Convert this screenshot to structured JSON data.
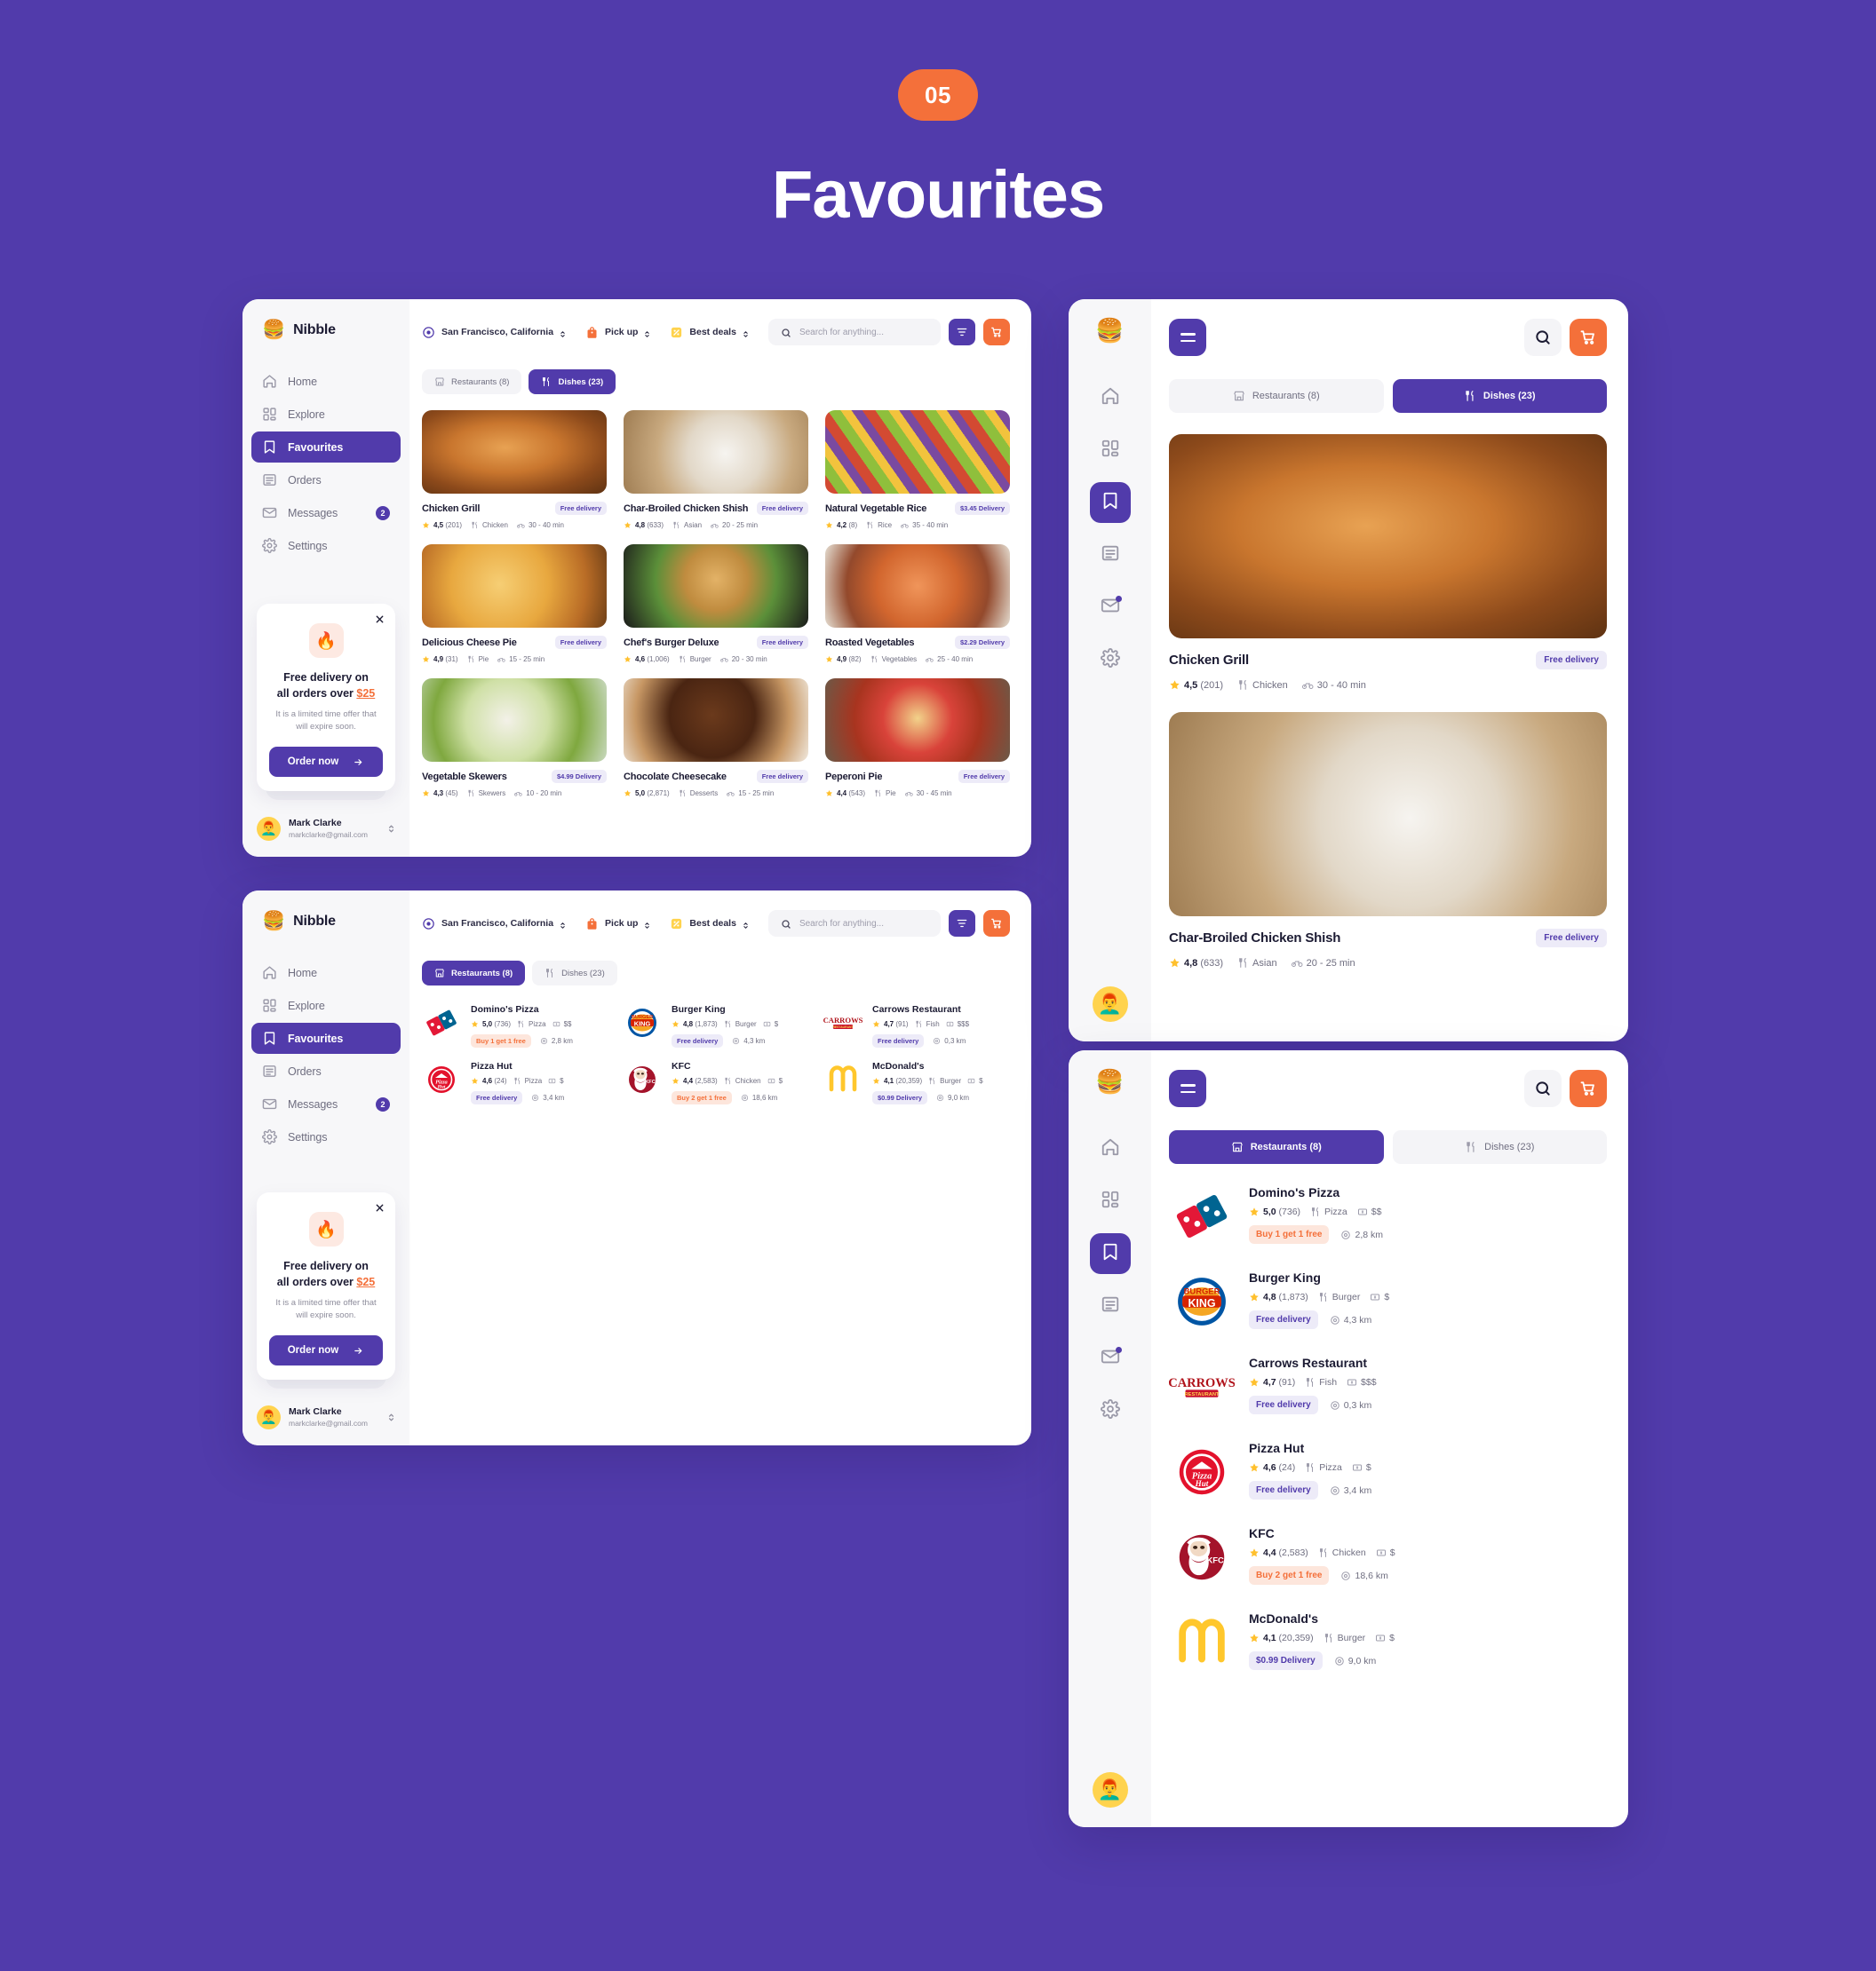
{
  "header": {
    "step": "05",
    "title": "Favourites"
  },
  "brand": {
    "name": "Nibble",
    "logo_icon": "burger-logo"
  },
  "sidebar": {
    "items": [
      {
        "label": "Home",
        "icon": "home-icon",
        "badge": ""
      },
      {
        "label": "Explore",
        "icon": "grid-icon",
        "badge": ""
      },
      {
        "label": "Favourites",
        "icon": "bookmark-icon",
        "badge": ""
      },
      {
        "label": "Orders",
        "icon": "list-icon",
        "badge": ""
      },
      {
        "label": "Messages",
        "icon": "mail-icon",
        "badge": "2"
      },
      {
        "label": "Settings",
        "icon": "gear-icon",
        "badge": ""
      }
    ],
    "active": "Favourites"
  },
  "promo": {
    "icon": "flame-icon",
    "close_icon": "close-icon",
    "title_line1": "Free delivery on",
    "title_line2": "all orders over ",
    "amount": "$25",
    "subtitle": "It is a limited time offer that will expire soon.",
    "button_label": "Order now",
    "button_icon": "arrow-right-icon"
  },
  "user": {
    "name": "Mark Clarke",
    "email": "markclarke@gmail.com",
    "avatar_icon": "avatar",
    "expander_icon": "chevron-updown-icon"
  },
  "toolbar": {
    "location": {
      "label": "San Francisco, California",
      "icon": "location-target-icon"
    },
    "mode": {
      "label": "Pick up",
      "icon": "bag-icon"
    },
    "deals": {
      "label": "Best deals",
      "icon": "discount-icon"
    },
    "search": {
      "placeholder": "Search for anything...",
      "value": "",
      "icon": "search-icon"
    },
    "filter_icon": "filter-icon",
    "cart_icon": "cart-icon"
  },
  "tabs": {
    "restaurants": {
      "label": "Restaurants (8)",
      "icon": "store-icon"
    },
    "dishes": {
      "label": "Dishes (23)",
      "icon": "cutlery-icon"
    }
  },
  "colors": {
    "background": "#513BAB",
    "primary": "#513BAB",
    "accent": "#F4703A",
    "star": "#FFC02D",
    "pill_purple_bg": "#EDEBF8",
    "pill_orange_bg": "#FDE6DC"
  },
  "dishes": [
    {
      "name": "Chicken Grill",
      "delivery": "Free delivery",
      "delivery_type": "free",
      "rating": "4,5",
      "reviews": "(201)",
      "category": "Chicken",
      "time": "30 - 40 min",
      "photo": "ph-chicken"
    },
    {
      "name": "Char-Broiled Chicken Shish",
      "delivery": "Free delivery",
      "delivery_type": "free",
      "rating": "4,8",
      "reviews": "(633)",
      "category": "Asian",
      "time": "20 - 25 min",
      "photo": "ph-shish"
    },
    {
      "name": "Natural Vegetable Rice",
      "delivery": "$3.45 Delivery",
      "delivery_type": "paid",
      "rating": "4,2",
      "reviews": "(8)",
      "category": "Rice",
      "time": "35 - 40 min",
      "photo": "ph-vegrice"
    },
    {
      "name": "Delicious Cheese Pie",
      "delivery": "Free delivery",
      "delivery_type": "free",
      "rating": "4,9",
      "reviews": "(31)",
      "category": "Pie",
      "time": "15 - 25 min",
      "photo": "ph-cheesepie"
    },
    {
      "name": "Chef's Burger Deluxe",
      "delivery": "Free delivery",
      "delivery_type": "free",
      "rating": "4,6",
      "reviews": "(1,006)",
      "category": "Burger",
      "time": "20 - 30 min",
      "photo": "ph-burger"
    },
    {
      "name": "Roasted Vegetables",
      "delivery": "$2.29 Delivery",
      "delivery_type": "paid",
      "rating": "4,9",
      "reviews": "(82)",
      "category": "Vegetables",
      "time": "25 - 40 min",
      "photo": "ph-roasted"
    },
    {
      "name": "Vegetable Skewers",
      "delivery": "$4.99 Delivery",
      "delivery_type": "paid",
      "rating": "4,3",
      "reviews": "(45)",
      "category": "Skewers",
      "time": "10 - 20 min",
      "photo": "ph-skewers"
    },
    {
      "name": "Chocolate Cheesecake",
      "delivery": "Free delivery",
      "delivery_type": "free",
      "rating": "5,0",
      "reviews": "(2,871)",
      "category": "Desserts",
      "time": "15 - 25 min",
      "photo": "ph-cheesecake"
    },
    {
      "name": "Peperoni Pie",
      "delivery": "Free delivery",
      "delivery_type": "free",
      "rating": "4,4",
      "reviews": "(543)",
      "category": "Pie",
      "time": "30 - 45 min",
      "photo": "ph-peperoni"
    }
  ],
  "restaurants": [
    {
      "name": "Domino's Pizza",
      "rating": "5,0",
      "reviews": "(736)",
      "category": "Pizza",
      "price": "$$",
      "offer": "Buy 1 get 1 free",
      "offer_type": "orange",
      "distance": "2,8 km",
      "logo": "dominos-logo"
    },
    {
      "name": "Burger King",
      "rating": "4,8",
      "reviews": "(1,873)",
      "category": "Burger",
      "price": "$",
      "offer": "Free delivery",
      "offer_type": "purple",
      "distance": "4,3 km",
      "logo": "burger-king-logo"
    },
    {
      "name": "Carrows Restaurant",
      "rating": "4,7",
      "reviews": "(91)",
      "category": "Fish",
      "price": "$$$",
      "offer": "Free delivery",
      "offer_type": "purple",
      "distance": "0,3 km",
      "logo": "carrows-logo"
    },
    {
      "name": "Pizza Hut",
      "rating": "4,6",
      "reviews": "(24)",
      "category": "Pizza",
      "price": "$",
      "offer": "Free delivery",
      "offer_type": "purple",
      "distance": "3,4 km",
      "logo": "pizza-hut-logo"
    },
    {
      "name": "KFC",
      "rating": "4,4",
      "reviews": "(2,583)",
      "category": "Chicken",
      "price": "$",
      "offer": "Buy 2 get 1 free",
      "offer_type": "orange",
      "distance": "18,6 km",
      "logo": "kfc-logo"
    },
    {
      "name": "McDonald's",
      "rating": "4,1",
      "reviews": "(20,359)",
      "category": "Burger",
      "price": "$",
      "offer": "$0.99 Delivery",
      "offer_type": "purple",
      "distance": "9,0 km",
      "logo": "mcdonalds-logo"
    }
  ],
  "mobile": {
    "menu_icon": "hamburger-icon",
    "search_icon": "search-icon",
    "cart_icon": "cart-icon",
    "rail_items": [
      {
        "icon": "home-icon",
        "badge": false
      },
      {
        "icon": "grid-icon",
        "badge": false
      },
      {
        "icon": "bookmark-icon",
        "badge": false
      },
      {
        "icon": "list-icon",
        "badge": false
      },
      {
        "icon": "mail-icon",
        "badge": true
      },
      {
        "icon": "gear-icon",
        "badge": false
      }
    ],
    "panel1_active_tab": "Dishes (23)",
    "panel2_active_tab": "Restaurants (8)",
    "panel1_dishes": [
      0,
      1
    ]
  }
}
